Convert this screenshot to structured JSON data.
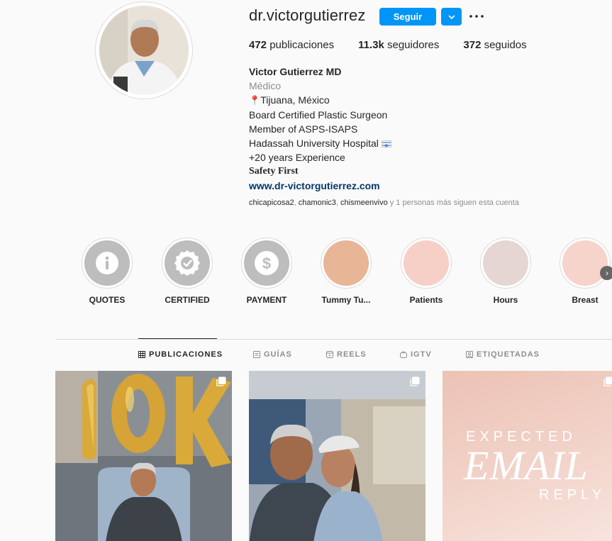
{
  "profile": {
    "username": "dr.victorgutierrez",
    "follow_label": "Seguir",
    "stats": {
      "posts_count": "472",
      "posts_label": "publicaciones",
      "followers_count": "11.3k",
      "followers_label": "seguidores",
      "following_count": "372",
      "following_label": "seguidos"
    },
    "bio": {
      "name": "Victor Gutierrez MD",
      "category": "Médico",
      "location_pin": "📍",
      "location": "Tijuana, México",
      "line1": "Board Certified Plastic Surgeon",
      "line2": "Member of ASPS-ISAPS",
      "line3": "Hadassah University Hospital",
      "line4": "+20 years Experience",
      "line5": "Safety First",
      "website": "www.dr-victorgutierrez.com"
    },
    "followed_by": {
      "user1": "chicapicosa2",
      "sep1": ", ",
      "user2": "chamonic3",
      "sep2": ", ",
      "user3": "chismeenvivo",
      "suffix": " y 1 personas más siguen esta cuenta"
    }
  },
  "highlights": [
    {
      "label": "QUOTES",
      "icon": "info-icon",
      "color": "#bdbdbd"
    },
    {
      "label": "CERTIFIED",
      "icon": "certified-badge-icon",
      "color": "#bdbdbd"
    },
    {
      "label": "PAYMENT",
      "icon": "dollar-icon",
      "color": "#bdbdbd"
    },
    {
      "label": "Tummy Tu...",
      "icon": "",
      "color": "#e9b597"
    },
    {
      "label": "Patients",
      "icon": "",
      "color": "#f6d0c6"
    },
    {
      "label": "Hours",
      "icon": "",
      "color": "#e6d6d3"
    },
    {
      "label": "Breast",
      "icon": "",
      "color": "#f6d3cb"
    }
  ],
  "tabs": [
    {
      "label": "PUBLICACIONES",
      "icon": "grid-icon",
      "active": true
    },
    {
      "label": "GUÍAS",
      "icon": "guides-icon",
      "active": false
    },
    {
      "label": "REELS",
      "icon": "reels-icon",
      "active": false
    },
    {
      "label": "IGTV",
      "icon": "igtv-icon",
      "active": false
    },
    {
      "label": "ETIQUETADAS",
      "icon": "tagged-icon",
      "active": false
    }
  ],
  "posts": [
    {
      "description_icon": "carousel-icon",
      "text_top": "",
      "text_mid": "",
      "text_bottom": ""
    },
    {
      "description_icon": "carousel-icon",
      "text_top": "",
      "text_mid": "",
      "text_bottom": ""
    },
    {
      "description_icon": "carousel-icon",
      "text_top": "EXPECTED",
      "text_mid": "EMAIL",
      "text_bottom": "REPLY"
    }
  ],
  "colors": {
    "accent": "#0095f6",
    "link": "#00376b",
    "muted": "#8e8e8e"
  }
}
